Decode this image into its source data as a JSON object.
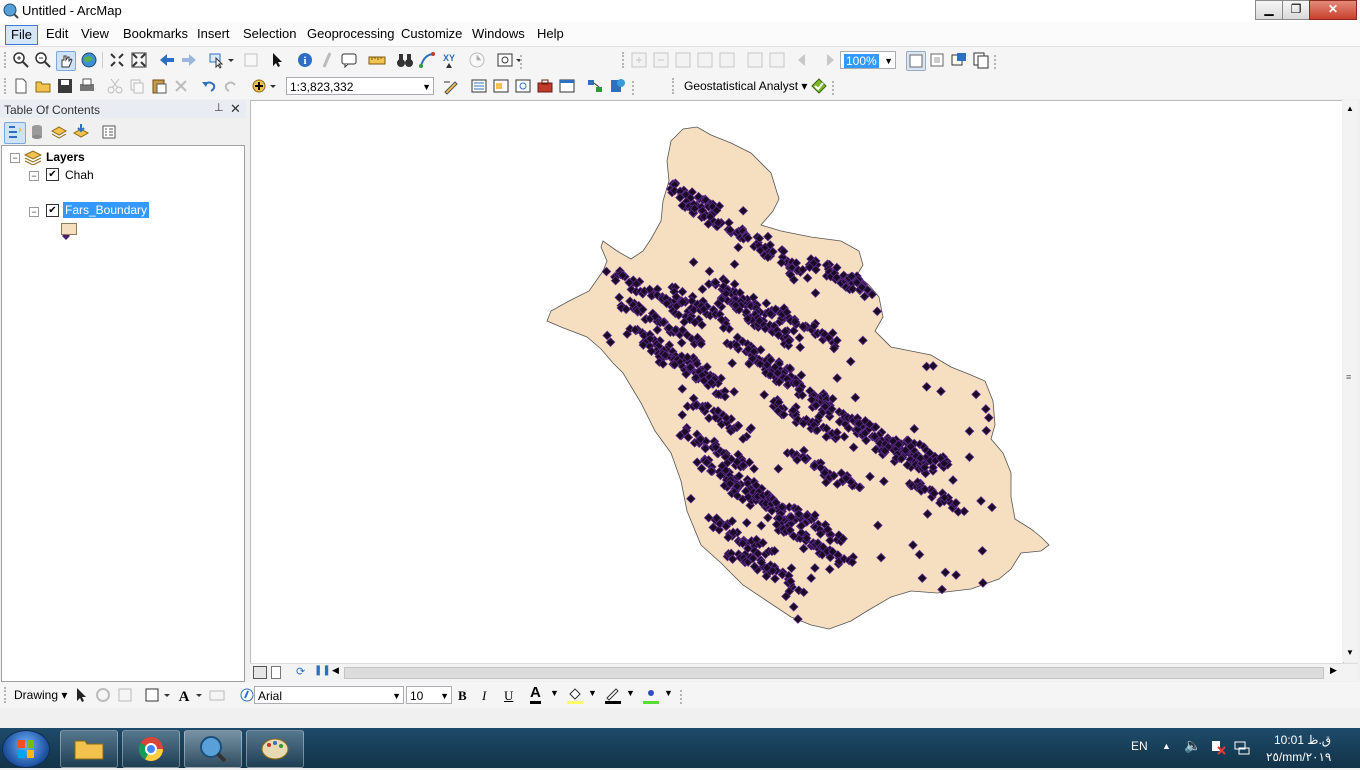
{
  "window": {
    "title": "Untitled - ArcMap",
    "minimize": "▁",
    "maximize": "❐",
    "close": "✕"
  },
  "menubar": {
    "items": [
      "File",
      "Edit",
      "View",
      "Bookmarks",
      "Insert",
      "Selection",
      "Geoprocessing",
      "Customize",
      "Windows",
      "Help"
    ]
  },
  "toolbar": {
    "layout_zoom": "100%",
    "scale": "1:3,823,332",
    "geostatistical_label": "Geostatistical Analyst ▾"
  },
  "toc": {
    "title": "Table Of Contents",
    "pin": "📌",
    "close": "✕",
    "root_label": "Layers",
    "layers": [
      {
        "name": "Chah",
        "checked": "✔",
        "symbol_color": "#4b1e6b"
      },
      {
        "name": "Fars_Boundary",
        "checked": "✔",
        "symbol_color": "#f5dfc0"
      }
    ]
  },
  "map": {
    "fill_color": "#f5dfc0",
    "point_color": "#1a0b26",
    "point_outline": "#5b2a86"
  },
  "drawing": {
    "label": "Drawing ▾",
    "font_name": "Arial",
    "font_size": "10",
    "bold": "B",
    "italic": "I",
    "underline": "U",
    "font_color_glyph": "A"
  },
  "taskbar": {
    "language": "EN",
    "time": "ق.ظ 10:01",
    "date": "٢٥/mm/٢٠١٩"
  },
  "colors": {
    "accent": "#3b7ad1",
    "selection": "#3399ff"
  }
}
